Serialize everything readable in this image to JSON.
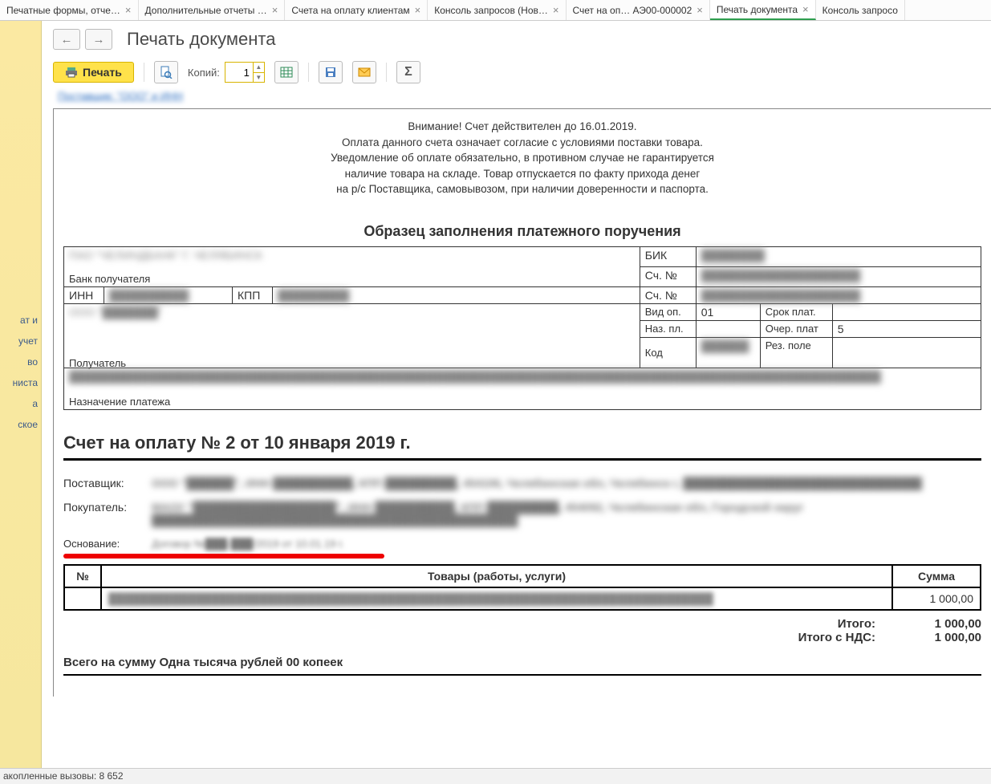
{
  "tabs": [
    {
      "label": "Печатные формы, отче…",
      "close": true
    },
    {
      "label": "Дополнительные отчеты …",
      "close": true
    },
    {
      "label": "Счета на оплату клиентам",
      "close": true
    },
    {
      "label": "Консоль запросов (Нов…",
      "close": true
    },
    {
      "label": "Счет на оп…  АЭ00-000002",
      "close": true
    },
    {
      "label": "Печать документа",
      "close": true,
      "active": true
    },
    {
      "label": "Консоль запросо",
      "close": false
    }
  ],
  "nav": {
    "back": "←",
    "fwd": "→"
  },
  "page_title": "Печать документа",
  "toolbar": {
    "print_label": "Печать",
    "copies_label": "Копий:",
    "copies_value": "1"
  },
  "top_link": "Поставщик: \"ООО\" и ИНН",
  "sidebar": {
    "items": [
      "ат и",
      "учет",
      "во",
      "ниста",
      "а",
      "ское"
    ]
  },
  "document": {
    "notice_lines": [
      "Внимание! Счет действителен до 16.01.2019.",
      "Оплата данного счета означает согласие с условиями поставки товара.",
      "Уведомление об оплате обязательно, в противном случае не гарантируется",
      "наличие товара на складе. Товар отпускается по факту прихода денег",
      "на р/с Поставщика, самовывозом, при наличии доверенности и паспорта."
    ],
    "section_title": "Образец заполнения платежного поручения",
    "bank": {
      "bank_name": "ПАО \"ЧЕЛИНДБАНК\" Г. ЧЕЛЯБИНСК",
      "bank_recipient_label": "Банк получателя",
      "bik_label": "БИК",
      "bik": "████████",
      "acc_label": "Сч. №",
      "acc1": "████████████████████",
      "inn_label": "ИНН",
      "inn": "██████████",
      "kpp_label": "КПП",
      "kpp": "█████████",
      "acc2": "████████████████████",
      "recipient": "ООО \"███████\"",
      "recipient_label": "Получатель",
      "vid_op_label": "Вид оп.",
      "vid_op": "01",
      "srok_label": "Срок плат.",
      "naz_label": "Наз. пл.",
      "ocher_label": "Очер. плат",
      "ocher": "5",
      "kod_label": "Код",
      "kod": "██████",
      "rez_label": "Рез. поле",
      "purpose": "██████████████████████████████████████████████████████████████████████████████████████████████████████",
      "purpose_label": "Назначение платежа"
    },
    "invoice_title": "Счет на оплату № 2 от 10 января 2019 г.",
    "parties": {
      "supplier_label": "Поставщик:",
      "supplier": "ООО \"██████\", ИНН ██████████, КПП █████████, 454106, Челябинская обл, Челябинск г, ██████████████████████████████",
      "buyer_label": "Покупатель:",
      "buyer": "МАОУ \"██████████████████\", ИНН ██████████, КПП █████████, 454092, Челябинская обл, Городской округ ██████████████████████████████████████████████",
      "basis_label": "Основание:",
      "basis": "Договор №███-███/2019 от 10.01.19 г."
    },
    "items_header": {
      "num": "№",
      "goods": "Товары (работы, услуги)",
      "sum": "Сумма"
    },
    "items": [
      {
        "num": "",
        "desc": "████████████████████████████████████████████████████████████████████████████",
        "sum": "1 000,00"
      }
    ],
    "totals": {
      "itogo_label": "Итого:",
      "itogo": "1 000,00",
      "itogo_nds_label": "Итого с НДС:",
      "itogo_nds": "1 000,00"
    },
    "sum_words": "Всего на сумму Одна тысяча рублей 00 копеек"
  },
  "status": "акопленные вызовы: 8 652"
}
